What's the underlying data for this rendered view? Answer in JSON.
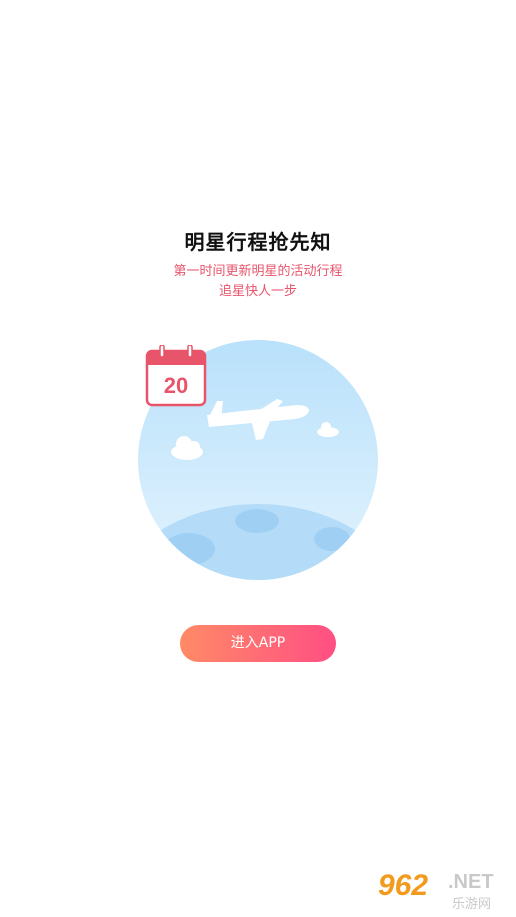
{
  "header": {
    "title": "明星行程抢先知",
    "subtitle_line1": "第一时间更新明星的活动行程",
    "subtitle_line2": "追星快人一步"
  },
  "illustration": {
    "calendar_day": "20",
    "calendar_icon": "calendar-icon",
    "plane_icon": "airplane-icon",
    "colors": {
      "accent": "#e8546a",
      "sky_top": "#bfe4fb",
      "sky_bottom": "#dff1fd",
      "earth": "#aed8f7"
    }
  },
  "actions": {
    "enter_label": "进入APP",
    "gradient_start": "#ff8a66",
    "gradient_end": "#ff4f83"
  },
  "watermark": {
    "number": "962",
    "domain": ".NET",
    "text": "乐游网"
  }
}
